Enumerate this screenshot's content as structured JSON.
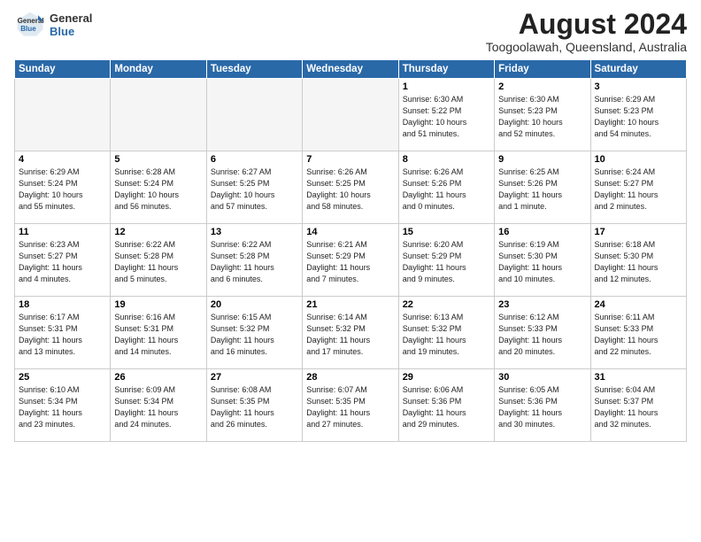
{
  "header": {
    "month_year": "August 2024",
    "location": "Toogoolawah, Queensland, Australia",
    "logo_line1": "General",
    "logo_line2": "Blue"
  },
  "weekdays": [
    "Sunday",
    "Monday",
    "Tuesday",
    "Wednesday",
    "Thursday",
    "Friday",
    "Saturday"
  ],
  "weeks": [
    [
      {
        "day": "",
        "info": "",
        "empty": true
      },
      {
        "day": "",
        "info": "",
        "empty": true
      },
      {
        "day": "",
        "info": "",
        "empty": true
      },
      {
        "day": "",
        "info": "",
        "empty": true
      },
      {
        "day": "1",
        "info": "Sunrise: 6:30 AM\nSunset: 5:22 PM\nDaylight: 10 hours\nand 51 minutes."
      },
      {
        "day": "2",
        "info": "Sunrise: 6:30 AM\nSunset: 5:23 PM\nDaylight: 10 hours\nand 52 minutes."
      },
      {
        "day": "3",
        "info": "Sunrise: 6:29 AM\nSunset: 5:23 PM\nDaylight: 10 hours\nand 54 minutes."
      }
    ],
    [
      {
        "day": "4",
        "info": "Sunrise: 6:29 AM\nSunset: 5:24 PM\nDaylight: 10 hours\nand 55 minutes."
      },
      {
        "day": "5",
        "info": "Sunrise: 6:28 AM\nSunset: 5:24 PM\nDaylight: 10 hours\nand 56 minutes."
      },
      {
        "day": "6",
        "info": "Sunrise: 6:27 AM\nSunset: 5:25 PM\nDaylight: 10 hours\nand 57 minutes."
      },
      {
        "day": "7",
        "info": "Sunrise: 6:26 AM\nSunset: 5:25 PM\nDaylight: 10 hours\nand 58 minutes."
      },
      {
        "day": "8",
        "info": "Sunrise: 6:26 AM\nSunset: 5:26 PM\nDaylight: 11 hours\nand 0 minutes."
      },
      {
        "day": "9",
        "info": "Sunrise: 6:25 AM\nSunset: 5:26 PM\nDaylight: 11 hours\nand 1 minute."
      },
      {
        "day": "10",
        "info": "Sunrise: 6:24 AM\nSunset: 5:27 PM\nDaylight: 11 hours\nand 2 minutes."
      }
    ],
    [
      {
        "day": "11",
        "info": "Sunrise: 6:23 AM\nSunset: 5:27 PM\nDaylight: 11 hours\nand 4 minutes."
      },
      {
        "day": "12",
        "info": "Sunrise: 6:22 AM\nSunset: 5:28 PM\nDaylight: 11 hours\nand 5 minutes."
      },
      {
        "day": "13",
        "info": "Sunrise: 6:22 AM\nSunset: 5:28 PM\nDaylight: 11 hours\nand 6 minutes."
      },
      {
        "day": "14",
        "info": "Sunrise: 6:21 AM\nSunset: 5:29 PM\nDaylight: 11 hours\nand 7 minutes."
      },
      {
        "day": "15",
        "info": "Sunrise: 6:20 AM\nSunset: 5:29 PM\nDaylight: 11 hours\nand 9 minutes."
      },
      {
        "day": "16",
        "info": "Sunrise: 6:19 AM\nSunset: 5:30 PM\nDaylight: 11 hours\nand 10 minutes."
      },
      {
        "day": "17",
        "info": "Sunrise: 6:18 AM\nSunset: 5:30 PM\nDaylight: 11 hours\nand 12 minutes."
      }
    ],
    [
      {
        "day": "18",
        "info": "Sunrise: 6:17 AM\nSunset: 5:31 PM\nDaylight: 11 hours\nand 13 minutes."
      },
      {
        "day": "19",
        "info": "Sunrise: 6:16 AM\nSunset: 5:31 PM\nDaylight: 11 hours\nand 14 minutes."
      },
      {
        "day": "20",
        "info": "Sunrise: 6:15 AM\nSunset: 5:32 PM\nDaylight: 11 hours\nand 16 minutes."
      },
      {
        "day": "21",
        "info": "Sunrise: 6:14 AM\nSunset: 5:32 PM\nDaylight: 11 hours\nand 17 minutes."
      },
      {
        "day": "22",
        "info": "Sunrise: 6:13 AM\nSunset: 5:32 PM\nDaylight: 11 hours\nand 19 minutes."
      },
      {
        "day": "23",
        "info": "Sunrise: 6:12 AM\nSunset: 5:33 PM\nDaylight: 11 hours\nand 20 minutes."
      },
      {
        "day": "24",
        "info": "Sunrise: 6:11 AM\nSunset: 5:33 PM\nDaylight: 11 hours\nand 22 minutes."
      }
    ],
    [
      {
        "day": "25",
        "info": "Sunrise: 6:10 AM\nSunset: 5:34 PM\nDaylight: 11 hours\nand 23 minutes."
      },
      {
        "day": "26",
        "info": "Sunrise: 6:09 AM\nSunset: 5:34 PM\nDaylight: 11 hours\nand 24 minutes."
      },
      {
        "day": "27",
        "info": "Sunrise: 6:08 AM\nSunset: 5:35 PM\nDaylight: 11 hours\nand 26 minutes."
      },
      {
        "day": "28",
        "info": "Sunrise: 6:07 AM\nSunset: 5:35 PM\nDaylight: 11 hours\nand 27 minutes."
      },
      {
        "day": "29",
        "info": "Sunrise: 6:06 AM\nSunset: 5:36 PM\nDaylight: 11 hours\nand 29 minutes."
      },
      {
        "day": "30",
        "info": "Sunrise: 6:05 AM\nSunset: 5:36 PM\nDaylight: 11 hours\nand 30 minutes."
      },
      {
        "day": "31",
        "info": "Sunrise: 6:04 AM\nSunset: 5:37 PM\nDaylight: 11 hours\nand 32 minutes."
      }
    ]
  ]
}
